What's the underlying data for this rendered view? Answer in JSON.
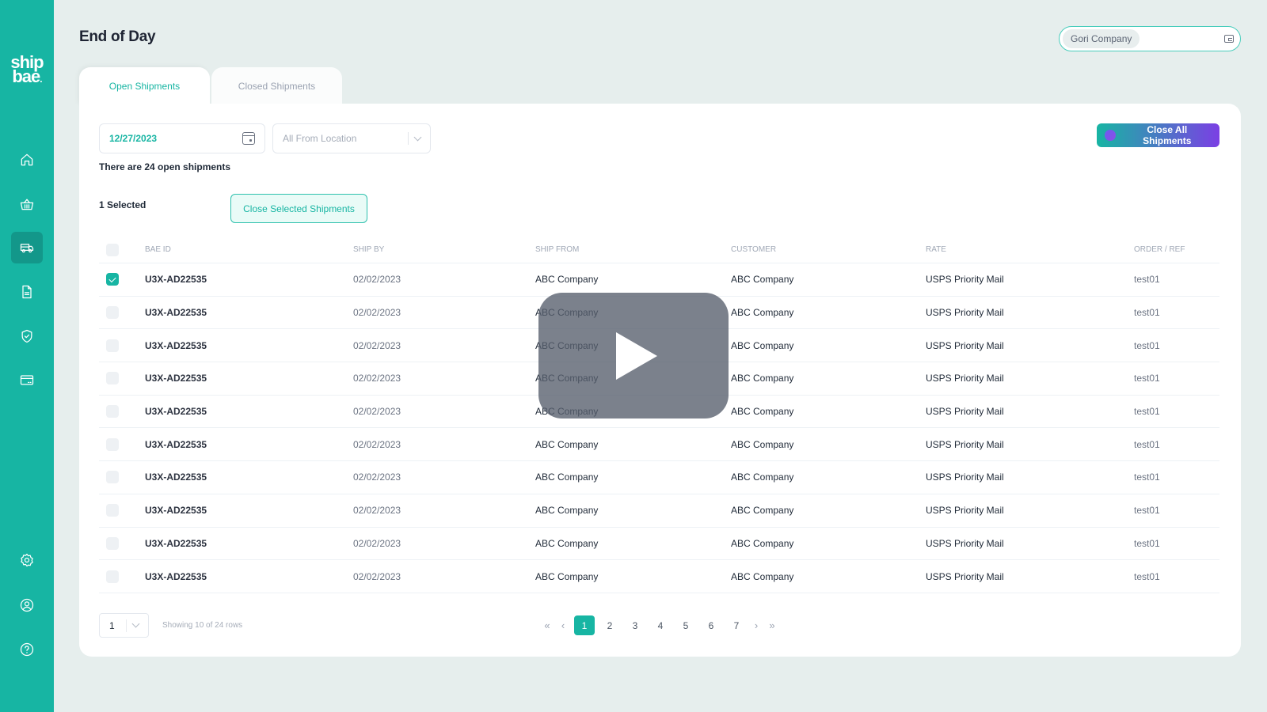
{
  "brand": {
    "line1": "ship",
    "line2": "bae",
    "dot": "."
  },
  "sidebar": {
    "items": [
      {
        "name": "home",
        "icon": "home-icon",
        "active": false
      },
      {
        "name": "orders",
        "icon": "basket-icon",
        "active": false
      },
      {
        "name": "shipments",
        "icon": "truck-icon",
        "active": true
      },
      {
        "name": "documents",
        "icon": "document-icon",
        "active": false
      },
      {
        "name": "protection",
        "icon": "shield-check-icon",
        "active": false
      },
      {
        "name": "billing",
        "icon": "credit-card-icon",
        "active": false
      }
    ],
    "bottom_items": [
      {
        "name": "settings",
        "icon": "gear-icon"
      },
      {
        "name": "account",
        "icon": "user-circle-icon"
      },
      {
        "name": "help",
        "icon": "help-circle-icon"
      }
    ]
  },
  "header": {
    "title": "End of Day",
    "company_selector": {
      "value": "Gori Company",
      "icon": "wallet-icon"
    }
  },
  "tabs": [
    {
      "label": "Open Shipments",
      "active": true
    },
    {
      "label": "Closed Shipments",
      "active": false
    }
  ],
  "filters": {
    "date": "12/27/2023",
    "location_placeholder": "All From Location"
  },
  "summary": {
    "open_count_text": "There are 24 open shipments",
    "selected_text": "1 Selected"
  },
  "buttons": {
    "close_all": "Close All Shipments",
    "close_selected": "Close Selected Shipments"
  },
  "colors": {
    "accent": "#17b5a3",
    "gradient_end": "#7b3fe4",
    "background": "#e6eeed"
  },
  "table": {
    "columns": [
      "BAE ID",
      "SHIP BY",
      "SHIP FROM",
      "CUSTOMER",
      "RATE",
      "ORDER / REF"
    ],
    "rows": [
      {
        "checked": true,
        "bae_id": "U3X-AD22535",
        "ship_by": "02/02/2023",
        "ship_from": "ABC Company",
        "customer": "ABC Company",
        "rate": "USPS Priority Mail",
        "ref": "test01"
      },
      {
        "checked": false,
        "bae_id": "U3X-AD22535",
        "ship_by": "02/02/2023",
        "ship_from": "ABC Company",
        "customer": "ABC Company",
        "rate": "USPS Priority Mail",
        "ref": "test01"
      },
      {
        "checked": false,
        "bae_id": "U3X-AD22535",
        "ship_by": "02/02/2023",
        "ship_from": "ABC Company",
        "customer": "ABC Company",
        "rate": "USPS Priority Mail",
        "ref": "test01"
      },
      {
        "checked": false,
        "bae_id": "U3X-AD22535",
        "ship_by": "02/02/2023",
        "ship_from": "ABC Company",
        "customer": "ABC Company",
        "rate": "USPS Priority Mail",
        "ref": "test01"
      },
      {
        "checked": false,
        "bae_id": "U3X-AD22535",
        "ship_by": "02/02/2023",
        "ship_from": "ABC Company",
        "customer": "ABC Company",
        "rate": "USPS Priority Mail",
        "ref": "test01"
      },
      {
        "checked": false,
        "bae_id": "U3X-AD22535",
        "ship_by": "02/02/2023",
        "ship_from": "ABC Company",
        "customer": "ABC Company",
        "rate": "USPS Priority Mail",
        "ref": "test01"
      },
      {
        "checked": false,
        "bae_id": "U3X-AD22535",
        "ship_by": "02/02/2023",
        "ship_from": "ABC Company",
        "customer": "ABC Company",
        "rate": "USPS Priority Mail",
        "ref": "test01"
      },
      {
        "checked": false,
        "bae_id": "U3X-AD22535",
        "ship_by": "02/02/2023",
        "ship_from": "ABC Company",
        "customer": "ABC Company",
        "rate": "USPS Priority Mail",
        "ref": "test01"
      },
      {
        "checked": false,
        "bae_id": "U3X-AD22535",
        "ship_by": "02/02/2023",
        "ship_from": "ABC Company",
        "customer": "ABC Company",
        "rate": "USPS Priority Mail",
        "ref": "test01"
      },
      {
        "checked": false,
        "bae_id": "U3X-AD22535",
        "ship_by": "02/02/2023",
        "ship_from": "ABC Company",
        "customer": "ABC Company",
        "rate": "USPS Priority Mail",
        "ref": "test01"
      }
    ]
  },
  "pagination": {
    "page_size": "1",
    "showing_text": "Showing 10 of 24 rows",
    "first": "«",
    "prev": "‹",
    "next": "›",
    "last": "»",
    "pages": [
      "1",
      "2",
      "3",
      "4",
      "5",
      "6",
      "7"
    ],
    "current": "1"
  },
  "video_overlay": {
    "icon": "play-icon"
  }
}
